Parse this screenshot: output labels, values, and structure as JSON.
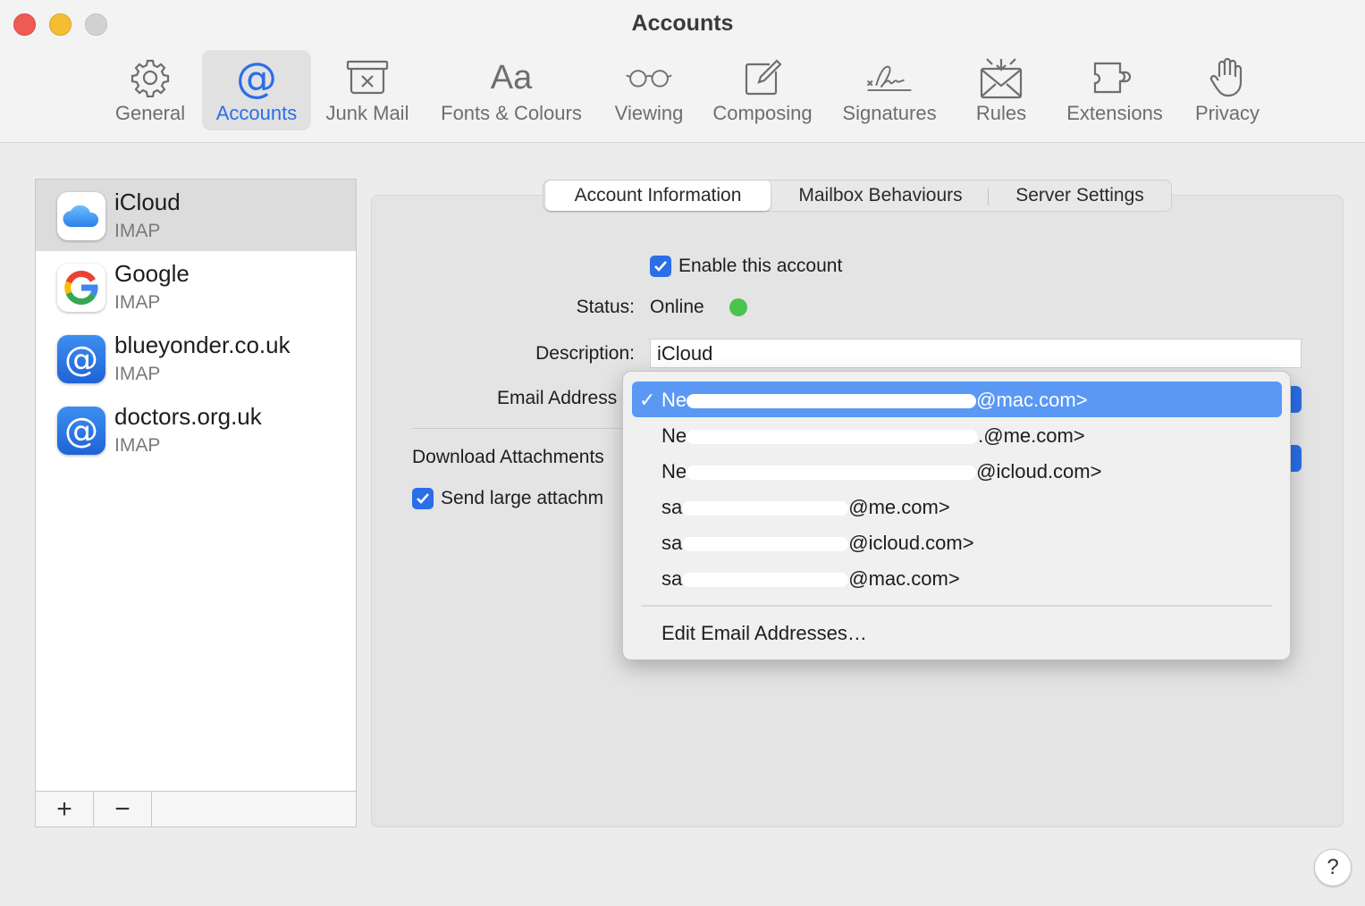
{
  "window": {
    "title": "Accounts"
  },
  "toolbar": {
    "items": [
      {
        "label": "General",
        "icon": "gear-icon"
      },
      {
        "label": "Accounts",
        "icon": "at-icon",
        "active": true
      },
      {
        "label": "Junk Mail",
        "icon": "junk-mail-icon"
      },
      {
        "label": "Fonts & Colours",
        "icon": "fonts-icon",
        "glyph": "Aa"
      },
      {
        "label": "Viewing",
        "icon": "glasses-icon"
      },
      {
        "label": "Composing",
        "icon": "compose-icon"
      },
      {
        "label": "Signatures",
        "icon": "signature-icon"
      },
      {
        "label": "Rules",
        "icon": "rules-icon"
      },
      {
        "label": "Extensions",
        "icon": "extensions-icon"
      },
      {
        "label": "Privacy",
        "icon": "hand-icon"
      }
    ]
  },
  "sidebar": {
    "accounts": [
      {
        "name": "iCloud",
        "type": "IMAP",
        "selected": true
      },
      {
        "name": "Google",
        "type": "IMAP"
      },
      {
        "name": "blueyonder.co.uk",
        "type": "IMAP"
      },
      {
        "name": "doctors.org.uk",
        "type": "IMAP"
      }
    ],
    "add_label": "+",
    "remove_label": "−"
  },
  "tabs": [
    {
      "label": "Account Information",
      "active": true
    },
    {
      "label": "Mailbox Behaviours"
    },
    {
      "label": "Server Settings"
    }
  ],
  "account_info": {
    "enable_label": "Enable this account",
    "status_label": "Status:",
    "status_value": "Online",
    "status_color": "#4cc24f",
    "description_label": "Description:",
    "description_value": "iCloud",
    "email_label": "Email Address",
    "download_label": "Download Attachments",
    "send_large_label": "Send large attachm"
  },
  "email_menu": {
    "checkmark": "✓",
    "items": [
      {
        "prefix": "Ne",
        "suffix": "@mac.com>",
        "selected": true
      },
      {
        "prefix": "Ne",
        "suffix": ".@me.com>"
      },
      {
        "prefix": "Ne",
        "suffix": "@icloud.com>"
      },
      {
        "prefix": "sa",
        "suffix": "@me.com>"
      },
      {
        "prefix": "sa",
        "suffix": "@icloud.com>"
      },
      {
        "prefix": "sa",
        "suffix": "@mac.com>"
      }
    ],
    "edit_label": "Edit Email Addresses…"
  },
  "help_label": "?",
  "colors": {
    "accent": "#2a6ee8",
    "menu_highlight": "#5a98f4"
  }
}
